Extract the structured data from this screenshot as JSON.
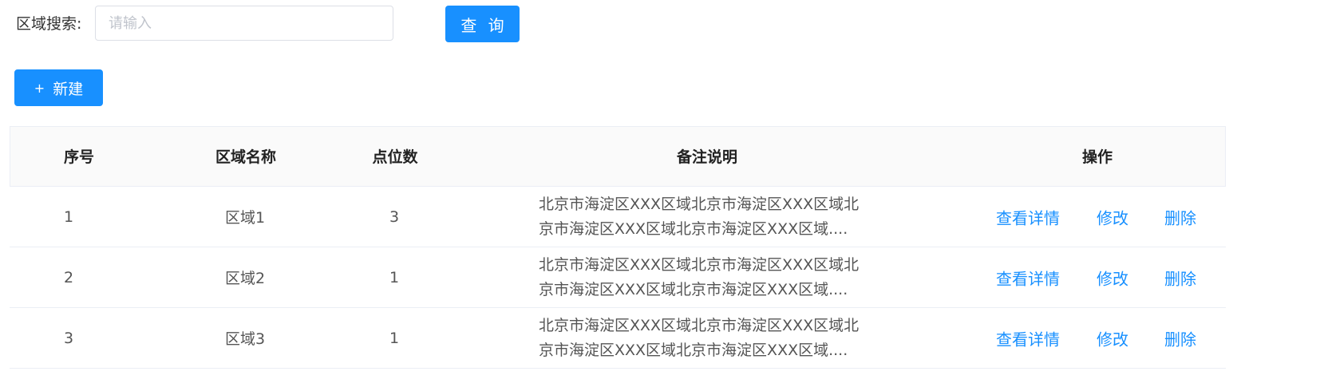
{
  "search": {
    "label": "区域搜索:",
    "placeholder": "请输入",
    "value": "",
    "query_label": "查 询"
  },
  "toolbar": {
    "new_icon": "+",
    "new_label": "新建"
  },
  "table": {
    "columns": {
      "index": "序号",
      "name": "区域名称",
      "count": "点位数",
      "remark": "备注说明",
      "ops": "操作"
    },
    "rows": [
      {
        "index": "1",
        "name": "区域1",
        "count": "3",
        "remark": "北京市海淀区XXX区域北京市海淀区XXX区域北京市海淀区XXX区域北京市海淀区XXX区域....",
        "view": "查看详情",
        "edit": "修改",
        "delete": "删除"
      },
      {
        "index": "2",
        "name": "区域2",
        "count": "1",
        "remark": "北京市海淀区XXX区域北京市海淀区XXX区域北京市海淀区XXX区域北京市海淀区XXX区域....",
        "view": "查看详情",
        "edit": "修改",
        "delete": "删除"
      },
      {
        "index": "3",
        "name": "区域3",
        "count": "1",
        "remark": "北京市海淀区XXX区域北京市海淀区XXX区域北京市海淀区XXX区域北京市海淀区XXX区域....",
        "view": "查看详情",
        "edit": "修改",
        "delete": "删除"
      }
    ]
  },
  "colors": {
    "primary": "#1890ff",
    "header_bg": "#fafafa",
    "border": "#ebeef5"
  }
}
